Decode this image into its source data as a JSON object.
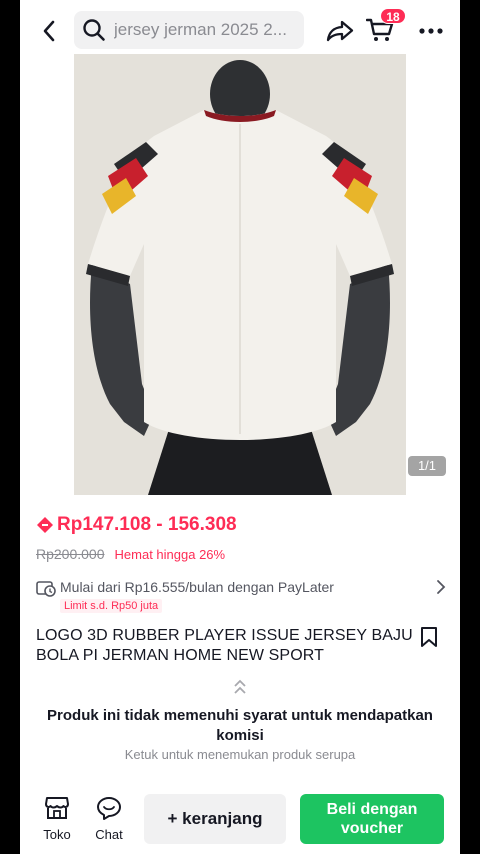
{
  "header": {
    "search_query": "jersey jerman 2025 2...",
    "cart_count": "18"
  },
  "product": {
    "image_counter": "1/1",
    "price_range": "Rp147.108 - 156.308",
    "original_price": "Rp200.000",
    "discount_label": "Hemat hingga 26%",
    "paylater_text": "Mulai dari Rp16.555/bulan dengan PayLater",
    "paylater_limit": "Limit s.d. Rp50 juta",
    "title": "LOGO 3D RUBBER PLAYER ISSUE JERSEY BAJU BOLA PI JERMAN HOME NEW SPORT"
  },
  "commission": {
    "notice": "Produk ini tidak memenuhi syarat untuk mendapatkan komisi",
    "hint": "Ketuk untuk menemukan produk serupa"
  },
  "bottom_bar": {
    "shop_label": "Toko",
    "chat_label": "Chat",
    "add_to_cart_label": "+ keranjang",
    "buy_label": "Beli dengan voucher"
  },
  "colors": {
    "accent": "#fe2c55",
    "buy_green": "#1dc461"
  }
}
